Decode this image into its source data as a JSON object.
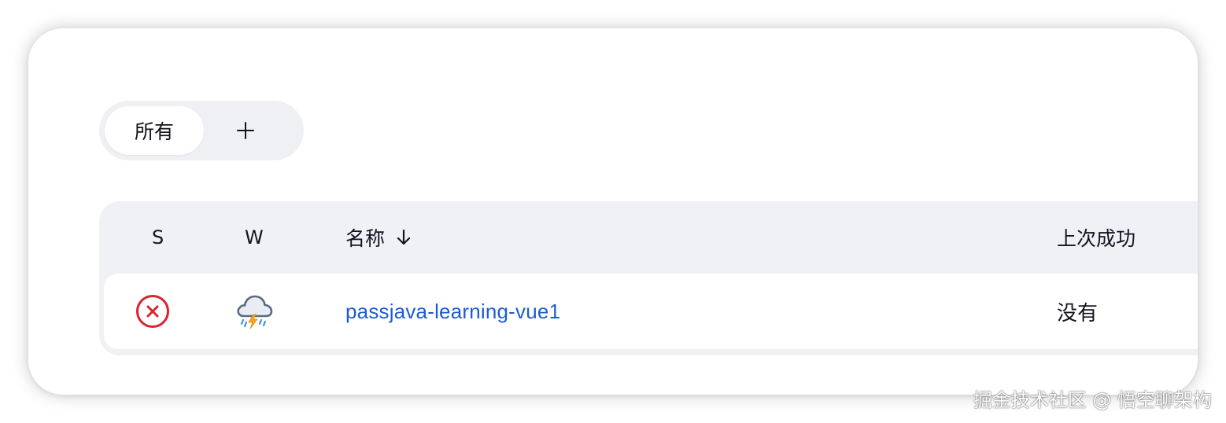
{
  "view_tabs": {
    "active_label": "所有",
    "add_label": "+"
  },
  "table": {
    "columns": {
      "status": "S",
      "weather": "W",
      "name": "名称",
      "last_success": "上次成功"
    },
    "sort": {
      "column": "name",
      "direction": "descending"
    },
    "rows": [
      {
        "status": "failed",
        "weather": "stormy",
        "name": "passjava-learning-vue1",
        "last_success": "没有"
      }
    ]
  },
  "colors": {
    "status_failed": "#d9232e",
    "link": "#1e5bd3",
    "header_bg": "#eff1f5",
    "lightning": "#f5a623",
    "cloud": "#5b6a82"
  },
  "watermark": "掘金技术社区 @ 悟空聊架构"
}
